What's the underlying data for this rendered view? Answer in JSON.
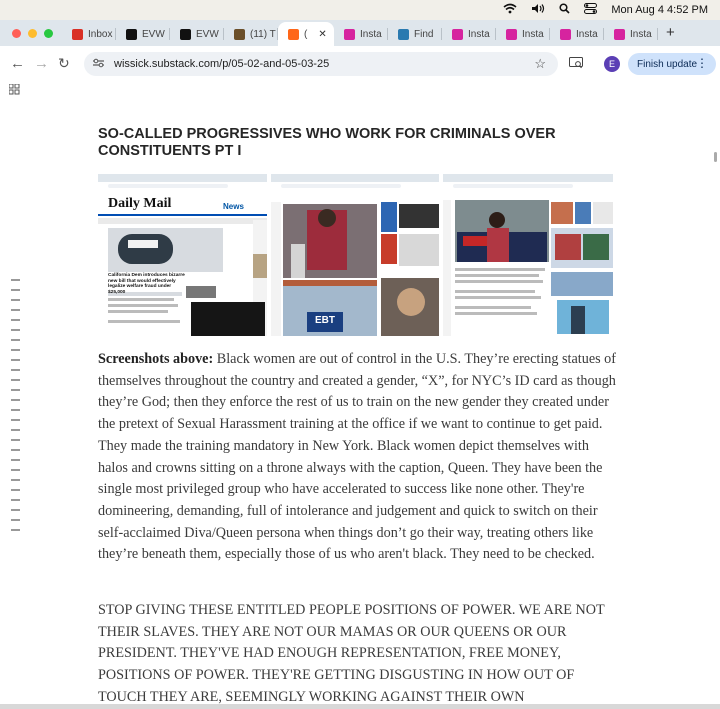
{
  "os": {
    "clock": "Mon Aug 4  4:52 PM"
  },
  "tabs": [
    {
      "label": "Inbox",
      "icon": "gmail-icon",
      "color": "#d93025"
    },
    {
      "label": "EVW",
      "icon": "x-logo-icon",
      "color": "#111111"
    },
    {
      "label": "EVW",
      "icon": "x-logo-icon",
      "color": "#111111"
    },
    {
      "label": "(11) T",
      "icon": "avatar-icon",
      "color": "#6b4f2a"
    },
    {
      "label": "(",
      "icon": "substack-icon",
      "color": "#ff6719"
    },
    {
      "label": "Insta",
      "icon": "instagram-icon",
      "color": "#d6249f"
    },
    {
      "label": "Find",
      "icon": "globe-icon",
      "color": "#2a7ab0"
    },
    {
      "label": "Insta",
      "icon": "instagram-icon",
      "color": "#d6249f"
    },
    {
      "label": "Insta",
      "icon": "instagram-icon",
      "color": "#d6249f"
    },
    {
      "label": "Insta",
      "icon": "instagram-icon",
      "color": "#d6249f"
    },
    {
      "label": "Insta",
      "icon": "instagram-icon",
      "color": "#d6249f"
    }
  ],
  "toolbar": {
    "url": "wissick.substack.com/p/05-02-and-05-03-25",
    "profile_initial": "E",
    "finish_update": "Finish update"
  },
  "article": {
    "title": "SO-CALLED PROGRESSIVES WHO WORK FOR CRIMINALS OVER CONSTITUENTS PT I",
    "screenshots": [
      {
        "tag": "Daily Mail",
        "headline": "California Dem introduces bizarre new bill that would effectively legalize welfare fraud under $25,000",
        "sub": "News"
      },
      {
        "tag": "",
        "headline": "EBT",
        "sub": ""
      },
      {
        "tag": "",
        "headline": "",
        "sub": ""
      }
    ],
    "para1_lead": "Screenshots above:",
    "para1_body": " Black women are out of control in the U.S. They’re erecting statues of themselves throughout the country and created a gender, “X”, for NYC’s ID card as though they’re God; then they enforce the rest of us to train on the new gender they created under the pretext of Sexual Harassment training at the office if we want to continue to get paid. They made the training mandatory in New York. Black women depict themselves with halos and crowns sitting on a throne always with the caption, Queen. They have been the single most privileged group who have accelerated to success like none other. They're domineering, demanding, full of intolerance and judgement and quick to switch on their self-acclaimed Diva/Queen persona when things don’t go their way, treating others like they’re beneath them, especially those of us who aren't black. They need to be checked.",
    "para2": "STOP GIVING THESE ENTITLED PEOPLE POSITIONS OF POWER. WE ARE NOT THEIR SLAVES. THEY ARE NOT OUR MAMAS OR OUR QUEENS OR OUR PRESIDENT. THEY'VE HAD ENOUGH REPRESENTATION, FREE MONEY, POSITIONS OF POWER. THEY'RE GETTING DISGUSTING IN HOW OUT OF TOUCH THEY ARE, SEEMINGLY WORKING AGAINST THEIR OWN"
  }
}
